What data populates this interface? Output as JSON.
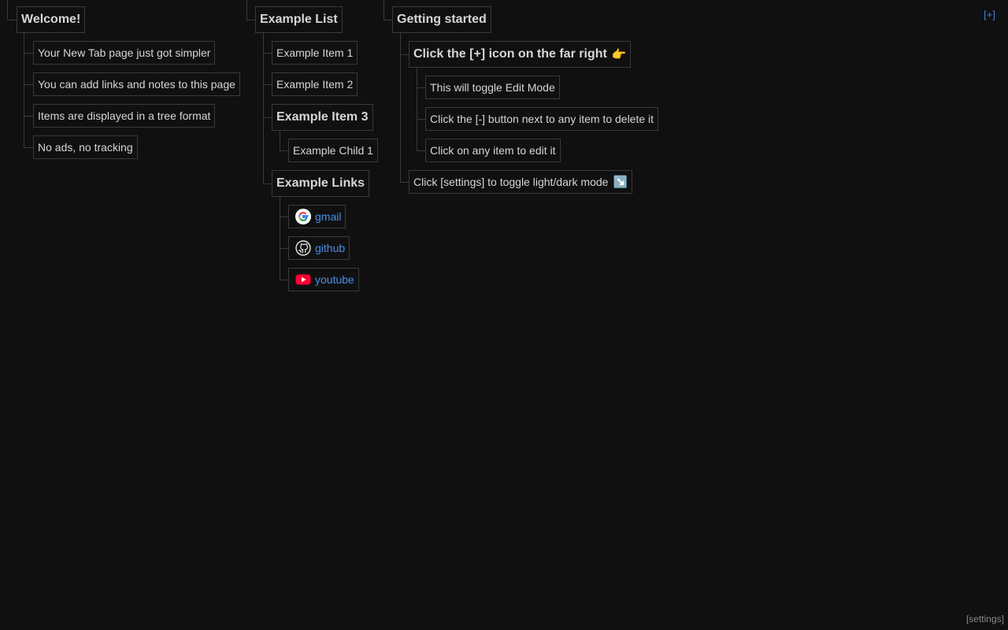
{
  "edit_toggle": "[+]",
  "settings_label": "[settings]",
  "columns": [
    {
      "title": "Welcome!",
      "items": [
        "Your New Tab page just got simpler",
        "You can add links and notes to this page",
        "Items are displayed in a tree format",
        "No ads, no tracking"
      ]
    },
    {
      "title": "Example List",
      "items": [
        "Example Item 1",
        "Example Item 2",
        "Example Item 3",
        "Example Child 1",
        "Example Links"
      ],
      "links": [
        {
          "label": "gmail",
          "icon": "google-icon"
        },
        {
          "label": "github",
          "icon": "github-icon"
        },
        {
          "label": "youtube",
          "icon": "youtube-icon"
        }
      ]
    },
    {
      "title": "Getting started",
      "items": [
        "Click the [+] icon on the far right",
        "This will toggle Edit Mode",
        "Click the [-] button next to any item to delete it",
        "Click on any item to edit it",
        "Click [settings] to toggle light/dark mode"
      ],
      "emojis": [
        "👉",
        "↘️"
      ]
    }
  ],
  "colors": {
    "background": "#101011",
    "border": "#3a3a3c",
    "text": "#d6d6d6",
    "link": "#4a8fe6",
    "accent": "#3f7fe0"
  }
}
